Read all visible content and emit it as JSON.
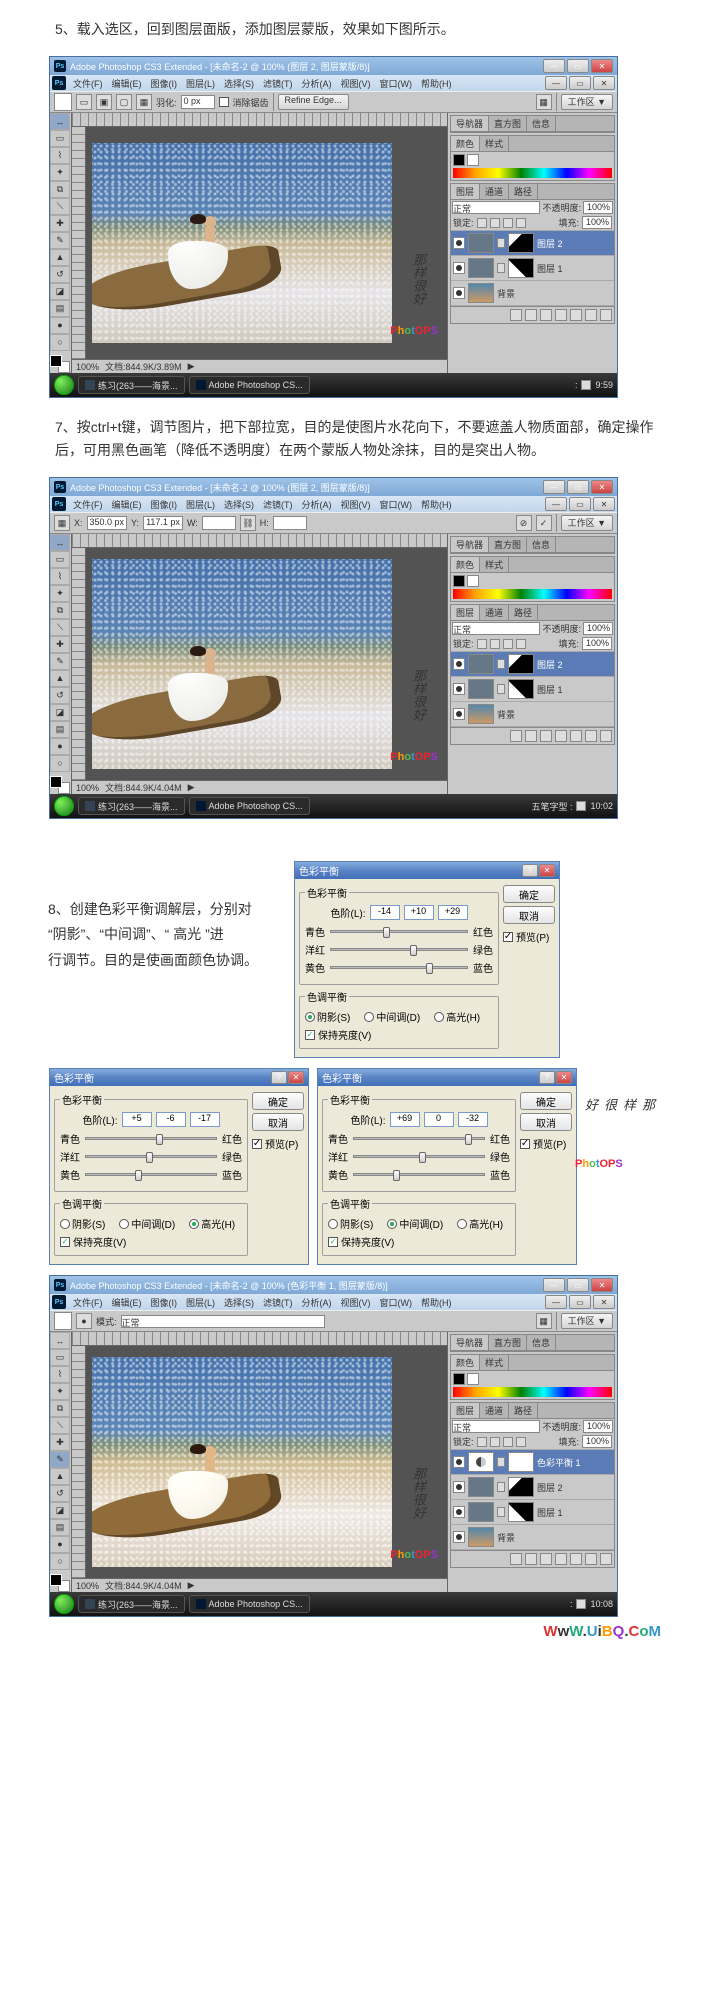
{
  "steps": {
    "s5": "5、载入选区，回到图层面版，添加图层蒙版，效果如下图所示。",
    "s7": "7、按ctrl+t键，调节图片，把下部拉宽，目的是使图片水花向下，不要遮盖人物质面部，确定操作后，可用黑色画笔（降低不透明度）在两个蒙版人物处涂抹，目的是突出人物。",
    "s8a": "8、创建色彩平衡调解层，分别对",
    "s8b": "“阴影”、“中间调”、“ 高光 ”进",
    "s8c": "行调节。目的是使画面颜色协调。"
  },
  "ps": {
    "apptitle": "Adobe Photoshop CS3 Extended - [未命名-2 @ 100% (图层 2, 图层蒙版/8)]",
    "apptitle2": "Adobe Photoshop CS3 Extended - [未命名-2 @ 100% (图层 2, 图层蒙版/8)]",
    "apptitle3": "Adobe Photoshop CS3 Extended - [未命名-2 @ 100% (色彩平衡 1, 图层蒙版/8)]",
    "menu": {
      "file": "文件(F)",
      "edit": "编辑(E)",
      "image": "图像(I)",
      "layer": "图层(L)",
      "select": "选择(S)",
      "filter": "滤镜(T)",
      "analysis": "分析(A)",
      "view": "视图(V)",
      "window": "窗口(W)",
      "help": "帮助(H)"
    },
    "opts1": {
      "feather_l": "羽化:",
      "feather_v": "0 px",
      "aa": "消除锯齿",
      "refine": "Refine Edge...",
      "work": "工作区 ▼"
    },
    "opts2": {
      "x": "X:",
      "xval": "350.0 px",
      "y": "Y:",
      "yval": "117.1 px",
      "w": "W:",
      "h": "H:",
      "ang": "",
      "work": "工作区 ▼"
    },
    "opts3": {
      "work": "工作区 ▼"
    },
    "status": {
      "zoom": "100%",
      "docsize": "文档:844.9K/3.89M",
      "docsize2": "文档:844.9K/4.04M",
      "docsize3": "文档:844.9K/4.04M",
      "ime": "五笔字型 :",
      "ime2": ":"
    },
    "panels": {
      "nav_tabs": [
        "导航器",
        "直方图",
        "信息"
      ],
      "color_tabs": [
        "颜色",
        "样式"
      ],
      "layer_tabs": [
        "图层",
        "通道",
        "路径"
      ],
      "blend": "正常",
      "opacity_l": "不透明度:",
      "opacity": "100%",
      "lock_l": "锁定:",
      "fill_l": "填充:",
      "fill": "100%",
      "layers_a": [
        {
          "name": "图层 2",
          "mask": true,
          "sel": true
        },
        {
          "name": "图层 1",
          "mask2": true
        },
        {
          "name": "背景",
          "bg": true
        }
      ],
      "layers_c": [
        {
          "name": "色彩平衡 1",
          "adj": true,
          "sel": true
        },
        {
          "name": "图层 2",
          "mask": true
        },
        {
          "name": "图层 1",
          "mask2": true
        },
        {
          "name": "背景",
          "bg": true
        }
      ]
    },
    "task": {
      "a": "练习(263——海景...",
      "b": "Adobe Photoshop CS...",
      "time1": "9:59",
      "time2": "10:02",
      "time3": "10:08"
    },
    "scene": {
      "sig": "那样很好",
      "brand": "PhotOPS"
    }
  },
  "cb": {
    "title": "色彩平衡",
    "ok": "确定",
    "cancel": "取消",
    "preview": "预览(P)",
    "grp1": "色彩平衡",
    "levels": "色阶(L):",
    "grp2": "色调平衡",
    "left": [
      "青色",
      "洋红",
      "黄色"
    ],
    "right": [
      "红色",
      "绿色",
      "蓝色"
    ],
    "shadows": "阴影(S)",
    "midtones": "中间调(D)",
    "highlights": "高光(H)",
    "lum": "保持亮度(V)",
    "d1": {
      "v1": "-14",
      "v2": "+10",
      "v3": "+29",
      "tone": "shadows",
      "thumbs": [
        38,
        58,
        70
      ]
    },
    "d2": {
      "v1": "+5",
      "v2": "-6",
      "v3": "-17",
      "tone": "highlights",
      "thumbs": [
        54,
        46,
        38
      ]
    },
    "d3": {
      "v1": "+69",
      "v2": "0",
      "v3": "-32",
      "tone": "midtones",
      "thumbs": [
        85,
        50,
        30
      ]
    }
  },
  "footer": "WwW.UiBQ.CoM"
}
